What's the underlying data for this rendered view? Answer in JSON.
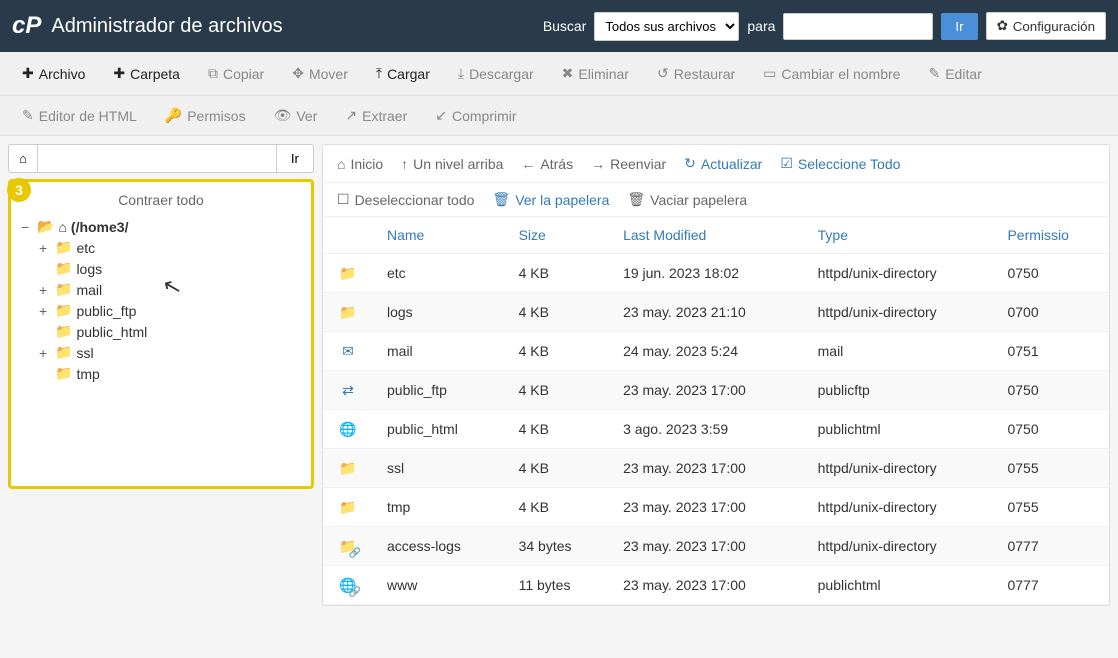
{
  "header": {
    "title": "Administrador de archivos",
    "search_label": "Buscar",
    "search_scope": "Todos sus archivos",
    "para_label": "para",
    "search_value": "",
    "go": "Ir",
    "config": "Configuración"
  },
  "toolbar1": {
    "file": "Archivo",
    "folder": "Carpeta",
    "copy": "Copiar",
    "move": "Mover",
    "upload": "Cargar",
    "download": "Descargar",
    "delete": "Eliminar",
    "restore": "Restaurar",
    "rename": "Cambiar el nombre",
    "edit": "Editar"
  },
  "toolbar2": {
    "html_editor": "Editor de HTML",
    "permissions": "Permisos",
    "view": "Ver",
    "extract": "Extraer",
    "compress": "Comprimir"
  },
  "pathbar": {
    "input": "",
    "go": "Ir"
  },
  "tree": {
    "collapse": "Contraer todo",
    "root": "(/home3/",
    "items": [
      {
        "label": "etc",
        "expandable": true
      },
      {
        "label": "logs",
        "expandable": false
      },
      {
        "label": "mail",
        "expandable": true
      },
      {
        "label": "public_ftp",
        "expandable": true
      },
      {
        "label": "public_html",
        "expandable": false
      },
      {
        "label": "ssl",
        "expandable": true
      },
      {
        "label": "tmp",
        "expandable": false
      }
    ],
    "step": "3"
  },
  "navbar": {
    "home": "Inicio",
    "up": "Un nivel arriba",
    "back": "Atrás",
    "forward": "Reenviar",
    "reload": "Actualizar",
    "select_all": "Seleccione Todo",
    "deselect_all": "Deseleccionar todo",
    "view_trash": "Ver la papelera",
    "empty_trash": "Vaciar papelera"
  },
  "table": {
    "headers": {
      "name": "Name",
      "size": "Size",
      "modified": "Last Modified",
      "type": "Type",
      "perm": "Permissio"
    },
    "rows": [
      {
        "icon": "folder",
        "name": "etc",
        "size": "4 KB",
        "modified": "19 jun. 2023 18:02",
        "type": "httpd/unix-directory",
        "perm": "0750"
      },
      {
        "icon": "folder",
        "name": "logs",
        "size": "4 KB",
        "modified": "23 may. 2023 21:10",
        "type": "httpd/unix-directory",
        "perm": "0700"
      },
      {
        "icon": "mail",
        "name": "mail",
        "size": "4 KB",
        "modified": "24 may. 2023 5:24",
        "type": "mail",
        "perm": "0751"
      },
      {
        "icon": "ftp",
        "name": "public_ftp",
        "size": "4 KB",
        "modified": "23 may. 2023 17:00",
        "type": "publicftp",
        "perm": "0750"
      },
      {
        "icon": "globe",
        "name": "public_html",
        "size": "4 KB",
        "modified": "3 ago. 2023 3:59",
        "type": "publichtml",
        "perm": "0750"
      },
      {
        "icon": "folder",
        "name": "ssl",
        "size": "4 KB",
        "modified": "23 may. 2023 17:00",
        "type": "httpd/unix-directory",
        "perm": "0755"
      },
      {
        "icon": "folder",
        "name": "tmp",
        "size": "4 KB",
        "modified": "23 may. 2023 17:00",
        "type": "httpd/unix-directory",
        "perm": "0755"
      },
      {
        "icon": "link",
        "name": "access-logs",
        "size": "34 bytes",
        "modified": "23 may. 2023 17:00",
        "type": "httpd/unix-directory",
        "perm": "0777"
      },
      {
        "icon": "globelink",
        "name": "www",
        "size": "11 bytes",
        "modified": "23 may. 2023 17:00",
        "type": "publichtml",
        "perm": "0777"
      }
    ]
  }
}
